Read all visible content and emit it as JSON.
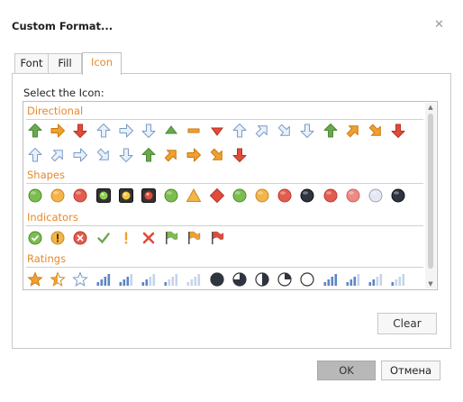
{
  "dialog": {
    "title": "Custom Format...",
    "close_icon": "close-icon"
  },
  "tabs": [
    {
      "label": "Font",
      "active": false
    },
    {
      "label": "Fill",
      "active": false
    },
    {
      "label": "Icon",
      "active": true
    }
  ],
  "icon_panel": {
    "label": "Select the Icon:",
    "sections": [
      {
        "title": "Directional",
        "rows": [
          [
            "arrow-up-green",
            "arrow-right-orange",
            "arrow-down-red",
            "arrow-up-outline",
            "arrow-right-outline",
            "arrow-down-outline",
            "triangle-up-green",
            "dash-orange",
            "triangle-down-red",
            "arrow-up-outline",
            "arrow-upright-outline",
            "arrow-downright-outline",
            "arrow-down-outline",
            "arrow-up-green",
            "arrow-upright-orange",
            "arrow-downright-orange",
            "arrow-down-red"
          ],
          [
            "arrow-up-outline",
            "arrow-upright-outline",
            "arrow-right-outline",
            "arrow-downright-outline",
            "arrow-down-outline",
            "arrow-up-green",
            "arrow-upright-orange",
            "arrow-right-orange",
            "arrow-downright-orange",
            "arrow-down-red"
          ]
        ]
      },
      {
        "title": "Shapes",
        "rows": [
          [
            "circle-green",
            "circle-yellow",
            "circle-red",
            "square-light-green",
            "square-light-yellow",
            "square-light-red",
            "circle-green",
            "triangle-yellow",
            "diamond-red",
            "circle-green",
            "circle-yellow",
            "circle-red",
            "circle-black",
            "circle-red",
            "circle-pink",
            "circle-gray",
            "circle-black"
          ]
        ]
      },
      {
        "title": "Indicators",
        "rows": [
          [
            "circle-check-green",
            "circle-exclamation-yellow",
            "circle-x-red",
            "check-green",
            "exclamation-yellow",
            "x-red",
            "flag-green",
            "flag-yellow",
            "flag-red"
          ]
        ]
      },
      {
        "title": "Ratings",
        "rows": [
          [
            "star-full",
            "star-half",
            "star-empty",
            "bars-4",
            "bars-3",
            "bars-2",
            "bars-1",
            "bars-0",
            "circle-full",
            "circle-three-quarter",
            "circle-half",
            "circle-quarter",
            "circle-empty",
            "bars-4",
            "bars-3",
            "bars-2",
            "bars-1"
          ]
        ]
      }
    ]
  },
  "buttons": {
    "clear": "Clear",
    "ok": "OK",
    "cancel": "Отмена"
  },
  "colors": {
    "accent": "#e8882b",
    "green": "#6aa84f",
    "orange": "#f0a030",
    "red": "#e04b3a",
    "outline_blue": "#7a9cc6"
  }
}
